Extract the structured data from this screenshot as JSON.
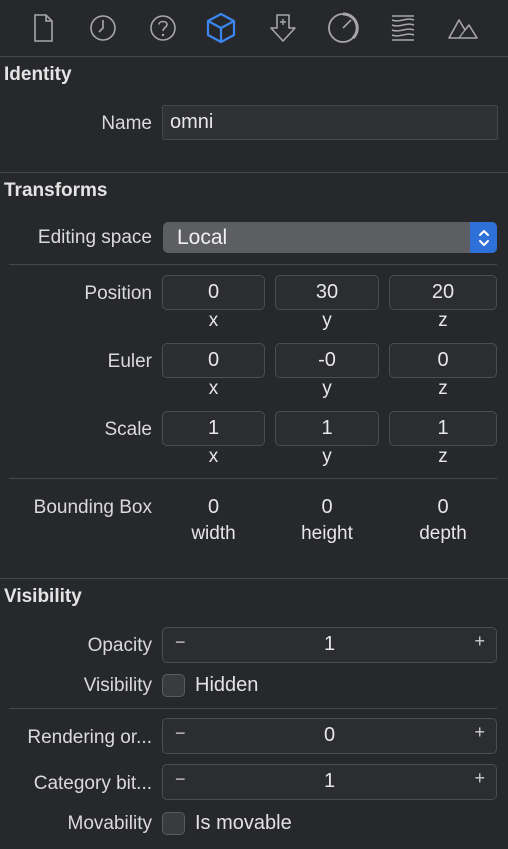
{
  "toolbar": {
    "icons": [
      "file-icon",
      "clock-icon",
      "help-icon",
      "node-cube-icon",
      "physics-arrow-icon",
      "material-circle-icon",
      "scene-layers-icon",
      "mountain-icon"
    ],
    "active_color": "#3b87f0",
    "icon_color": "#a7a7a9"
  },
  "identity": {
    "title": "Identity",
    "name_label": "Name",
    "name_value": "omni"
  },
  "transforms": {
    "title": "Transforms",
    "editing_space_label": "Editing space",
    "editing_space_value": "Local",
    "position": {
      "label": "Position",
      "x": "0",
      "y": "30",
      "z": "20"
    },
    "euler": {
      "label": "Euler",
      "x": "0",
      "y": "-0",
      "z": "0"
    },
    "scale": {
      "label": "Scale",
      "x": "1",
      "y": "1",
      "z": "1"
    },
    "axis": {
      "x": "x",
      "y": "y",
      "z": "z"
    },
    "bounding_box": {
      "label": "Bounding Box",
      "width": "0",
      "height": "0",
      "depth": "0",
      "width_label": "width",
      "height_label": "height",
      "depth_label": "depth"
    }
  },
  "visibility": {
    "title": "Visibility",
    "opacity_label": "Opacity",
    "opacity_value": "1",
    "visibility_label": "Visibility",
    "hidden_label": "Hidden",
    "rendering_order_label": "Rendering or...",
    "rendering_order_value": "0",
    "category_bit_label": "Category bit...",
    "category_bit_value": "1",
    "movability_label": "Movability",
    "is_movable_label": "Is movable",
    "minus": "−",
    "plus": "+"
  }
}
